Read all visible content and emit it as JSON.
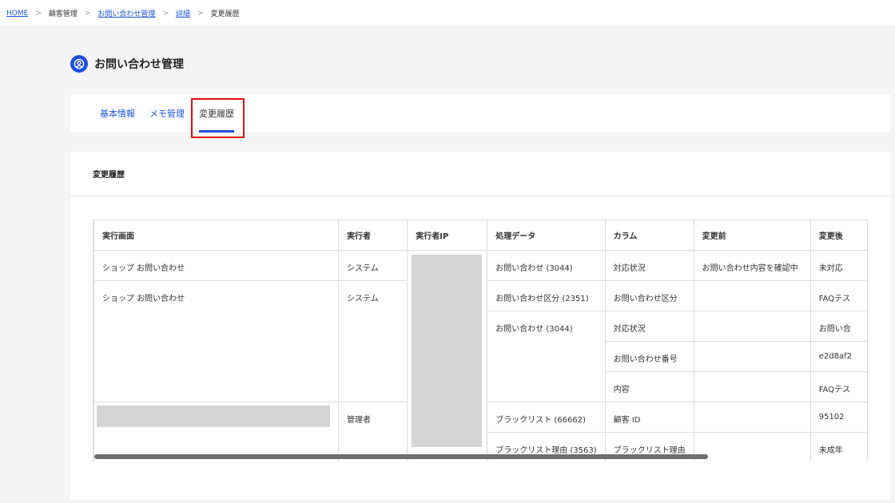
{
  "breadcrumb": {
    "home": "HOME",
    "sep": ">",
    "customers": "顧客管理",
    "inquiries": "お問い合わせ管理",
    "detail": "詳細",
    "current": "変更履歴"
  },
  "page": {
    "title": "お問い合わせ管理",
    "icon": "user-circle-icon",
    "accent": "#1f4fe0"
  },
  "tabs": [
    {
      "label": "基本情報"
    },
    {
      "label": "メモ管理"
    },
    {
      "label": "変更履歴"
    }
  ],
  "history": {
    "heading": "変更履歴",
    "columns": [
      "実行画面",
      "実行者",
      "実行者IP",
      "処理データ",
      "カラム",
      "変更前",
      "変更後"
    ],
    "rows": [
      {
        "screen": "ショップ お問い合わせ",
        "actor": "システム",
        "data": "お問い合わせ (3044)",
        "column": "対応状況",
        "before": "お問い合わせ内容を確認中",
        "after": "未対応"
      },
      {
        "screen": "ショップ お問い合わせ",
        "actor": "システム",
        "data": "お問い合わせ区分 (2351)",
        "column": "お問い合わせ区分",
        "before": "",
        "after": "FAQテス"
      },
      {
        "data": "お問い合わせ (3044)",
        "column": "対応状況",
        "before": "",
        "after": "お問い合"
      },
      {
        "column": "お問い合わせ番号",
        "before": "",
        "after": "e2d8af2"
      },
      {
        "column": "内容",
        "before": "",
        "after": "FAQテス"
      },
      {
        "actor": "管理者",
        "data": "ブラックリスト (66662)",
        "column": "顧客 ID",
        "before": "",
        "after": "95102"
      },
      {
        "data": "ブラックリスト理由 (3563)",
        "column": "ブラックリスト理由",
        "before": "",
        "after": "未成年"
      }
    ]
  }
}
